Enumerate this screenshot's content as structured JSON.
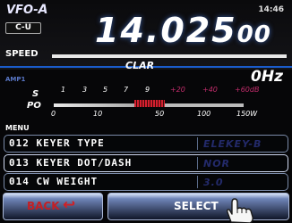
{
  "header": {
    "vfo_prefix": "VFO-",
    "vfo_letter": "A",
    "time": "14:46",
    "mode_badge": "C-U",
    "frequency_main": "14.025",
    "frequency_small": "00",
    "speed_label": "SPEED",
    "clar_label": "CLAR",
    "clar_value": "0",
    "clar_unit": "Hz",
    "amp_label": "AMP1"
  },
  "meter": {
    "s_label": "S",
    "po_label": "PO",
    "s_scale": [
      "1",
      "3",
      "5",
      "7",
      "9",
      "+20",
      "+40",
      "+60dB"
    ],
    "po_scale": [
      "0",
      "10",
      "50",
      "100",
      "150W"
    ],
    "level_fraction": 0.45
  },
  "menu": {
    "title": "MENU",
    "items": [
      {
        "label": "012 KEYER TYPE",
        "value": "ELEKEY-B"
      },
      {
        "label": "013 KEYER DOT/DASH",
        "value": "NOR"
      },
      {
        "label": "014 CW WEIGHT",
        "value": "3.0"
      }
    ]
  },
  "buttons": {
    "back": "BACK",
    "select": "SELECT"
  },
  "colors": {
    "accent_blue": "#1a5ccc",
    "back_red": "#c41f24",
    "meter_red": "#d41f2f"
  },
  "icons": {
    "back": "return-arrow-icon",
    "touch": "pointing-hand-icon"
  }
}
